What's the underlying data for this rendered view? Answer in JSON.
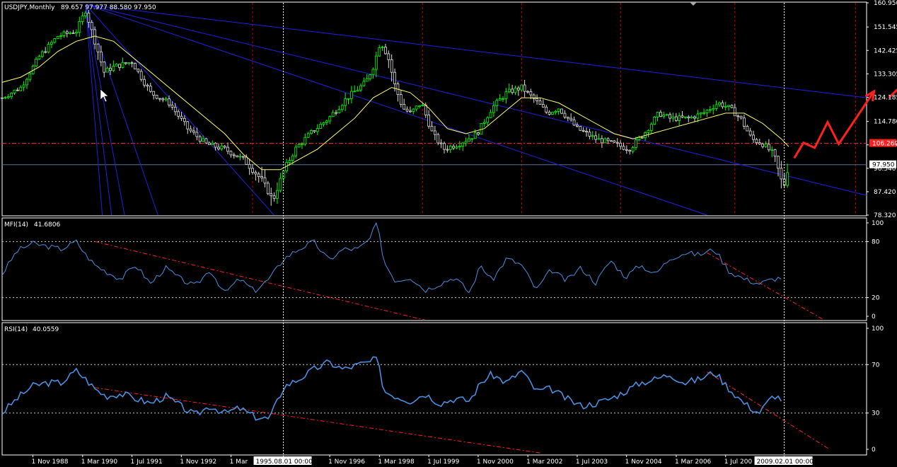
{
  "colors": {
    "background": "#000000",
    "frame": "#ffffff",
    "bull_candle": "#00ff00",
    "price_line": "#5a6e96",
    "ma": "#ffff64",
    "fan": "#2020e0",
    "red": "#ff2020",
    "vline_red": "#c00000",
    "indicator": "#4a8fe0",
    "dotted": "#c8c8c8"
  },
  "chart_data": [
    {
      "type": "candlestick",
      "panel": "price",
      "title": "USDJPY,Monthly",
      "ohlc_readout": "89.657 97.977 88.580 97.950",
      "ylim": [
        78.32,
        160.95
      ],
      "ytick_labels": [
        "160.950",
        "151.545",
        "142.425",
        "133.305",
        "124.185",
        "114.780",
        "105.660",
        "96.540",
        "87.420",
        "78.320"
      ],
      "ytick_values": [
        160.95,
        151.545,
        142.425,
        133.305,
        124.185,
        114.78,
        105.66,
        96.54,
        87.42,
        78.32
      ],
      "current_price_label": "97.950",
      "current_price": 97.95,
      "red_level_label": "106.260",
      "red_level": 106.26,
      "xlim": [
        1988.0,
        2011.3
      ],
      "x_tick_labels": [
        "1 Nov 1988",
        "1 Mar 1990",
        "1 Jul 1991",
        "1 Nov 1992",
        "1 Mar",
        "1 Nov 1996",
        "1 Mar 1998",
        "1 Jul 1999",
        "1 Nov 2000",
        "1 Mar 2002",
        "1 Jul 2003",
        "1 Nov 2004",
        "1 Mar 2006",
        "1 Jul 200"
      ],
      "x_tick_values": [
        1988.83,
        1990.17,
        1991.5,
        1992.83,
        1994.17,
        1996.83,
        1998.17,
        1999.5,
        2000.83,
        2002.17,
        2003.5,
        2004.83,
        2006.17,
        2007.5
      ],
      "crosshair_labels": [
        "1995.08.01 00:00",
        "2009.02.01 00:00"
      ],
      "crosshair_x": [
        1995.58,
        2009.08
      ],
      "vertical_red_lines": [
        1994.75,
        1999.33,
        2002.0,
        2004.67,
        2007.75,
        2011.0
      ],
      "anchor": {
        "x": 1990.25,
        "y": 160.3
      },
      "fan_lines": [
        {
          "to": [
            2011.3,
            124.0
          ]
        },
        {
          "to": [
            2011.3,
            86.0
          ]
        },
        {
          "to": [
            2007.0,
            78.32
          ]
        },
        {
          "to": [
            1995.33,
            78.32
          ]
        },
        {
          "to": [
            1992.2,
            78.32
          ]
        },
        {
          "to": [
            1991.3,
            78.32
          ]
        },
        {
          "to": [
            1990.95,
            78.32
          ]
        },
        {
          "to": [
            1990.7,
            78.32
          ]
        }
      ],
      "red_drawn_path": [
        [
          2009.35,
          100.5
        ],
        [
          2009.6,
          106.5
        ],
        [
          2009.9,
          104.5
        ],
        [
          2010.25,
          114.5
        ],
        [
          2010.55,
          106.0
        ],
        [
          2011.5,
          126.5
        ]
      ],
      "red_arrow_segment": [
        [
          2011.9,
          124.0
        ],
        [
          2012.9,
          138.0
        ]
      ],
      "close_series": {
        "x": [
          1988.0,
          1988.5,
          1989.0,
          1989.5,
          1990.0,
          1990.25,
          1990.5,
          1990.75,
          1991.0,
          1991.5,
          1992.0,
          1992.5,
          1993.0,
          1993.5,
          1994.0,
          1994.5,
          1995.0,
          1995.3,
          1995.6,
          1995.9,
          1996.3,
          1996.8,
          1997.3,
          1997.8,
          1998.0,
          1998.2,
          1998.4,
          1998.6,
          1998.8,
          1999.0,
          1999.3,
          1999.6,
          1999.9,
          2000.3,
          2000.8,
          2001.2,
          2001.6,
          2002.0,
          2002.3,
          2002.7,
          2003.0,
          2003.5,
          2004.0,
          2004.5,
          2004.9,
          2005.3,
          2005.7,
          2006.0,
          2006.5,
          2006.9,
          2007.3,
          2007.6,
          2007.9,
          2008.2,
          2008.5,
          2008.8,
          2009.0,
          2009.08,
          2009.2
        ],
        "y": [
          124,
          128,
          140,
          148,
          150,
          158,
          146,
          134,
          136,
          138,
          126,
          122,
          112,
          106,
          104,
          100,
          92,
          84,
          96,
          104,
          110,
          116,
          124,
          130,
          136,
          146,
          140,
          128,
          120,
          118,
          122,
          110,
          104,
          106,
          110,
          120,
          126,
          128,
          124,
          118,
          120,
          112,
          108,
          106,
          104,
          110,
          118,
          116,
          116,
          118,
          122,
          120,
          116,
          108,
          106,
          102,
          92,
          90,
          97.95
        ],
        "range": [
          2,
          3,
          4,
          4,
          3,
          6,
          7,
          5,
          5,
          4,
          4,
          3,
          4,
          4,
          4,
          5,
          8,
          8,
          5,
          4,
          3,
          4,
          5,
          5,
          6,
          7,
          8,
          8,
          5,
          5,
          4,
          5,
          4,
          4,
          4,
          5,
          5,
          5,
          4,
          4,
          4,
          4,
          4,
          4,
          4,
          4,
          4,
          4,
          4,
          4,
          4,
          4,
          4,
          5,
          5,
          6,
          8,
          8,
          8
        ]
      },
      "ma_series": {
        "x": [
          1988.0,
          1988.5,
          1989.0,
          1989.5,
          1990.0,
          1990.5,
          1991.0,
          1991.5,
          1992.0,
          1992.5,
          1993.0,
          1993.5,
          1994.0,
          1994.5,
          1995.0,
          1995.5,
          1996.0,
          1996.5,
          1997.0,
          1997.5,
          1998.0,
          1998.5,
          1999.0,
          1999.5,
          2000.0,
          2000.5,
          2001.0,
          2001.5,
          2002.0,
          2002.5,
          2003.0,
          2003.5,
          2004.0,
          2004.5,
          2005.0,
          2005.5,
          2006.0,
          2006.5,
          2007.0,
          2007.5,
          2008.0,
          2008.5,
          2009.0,
          2009.2
        ],
        "y": [
          130,
          132,
          136,
          142,
          146,
          148,
          146,
          140,
          134,
          128,
          122,
          116,
          110,
          102,
          96,
          96,
          100,
          104,
          110,
          116,
          124,
          128,
          126,
          120,
          112,
          110,
          112,
          118,
          124,
          124,
          122,
          118,
          114,
          110,
          108,
          110,
          112,
          114,
          116,
          118,
          118,
          114,
          108,
          105
        ]
      }
    },
    {
      "type": "line",
      "panel": "mfi",
      "title": "MFI(14)",
      "value_readout": "41.6806",
      "ylim": [
        0,
        100
      ],
      "ytick_labels": [
        "100",
        "80",
        "20",
        "0"
      ],
      "ytick_values": [
        100,
        80,
        20,
        0
      ],
      "dotted_levels": [
        80,
        20
      ],
      "series": [
        {
          "x": [
            1988.0,
            1988.4,
            1988.8,
            1989.2,
            1989.6,
            1990.0,
            1990.25,
            1990.5,
            1990.8,
            1991.2,
            1991.6,
            1992.0,
            1992.4,
            1992.8,
            1993.2,
            1993.6,
            1994.0,
            1994.4,
            1994.8,
            1995.2,
            1995.6,
            1996.0,
            1996.4,
            1996.8,
            1997.2,
            1997.6,
            1997.9,
            1998.1,
            1998.3,
            1998.6,
            1999.0,
            1999.4,
            1999.8,
            2000.2,
            2000.6,
            2000.9,
            2001.2,
            2001.6,
            2002.0,
            2002.4,
            2002.8,
            2003.2,
            2003.6,
            2004.0,
            2004.4,
            2004.8,
            2005.2,
            2005.6,
            2006.0,
            2006.4,
            2006.8,
            2007.2,
            2007.6,
            2008.0,
            2008.4,
            2008.8,
            2009.08
          ],
          "y": [
            45,
            70,
            78,
            75,
            72,
            80,
            66,
            55,
            48,
            40,
            55,
            35,
            52,
            40,
            32,
            50,
            25,
            40,
            27,
            40,
            62,
            72,
            80,
            60,
            72,
            72,
            82,
            100,
            58,
            38,
            42,
            28,
            35,
            42,
            25,
            55,
            38,
            62,
            55,
            28,
            50,
            38,
            52,
            36,
            60,
            42,
            55,
            45,
            62,
            68,
            66,
            72,
            48,
            40,
            35,
            40,
            42
          ]
        }
      ],
      "trendlines": [
        {
          "points": [
            [
              1990.5,
              80
            ],
            [
              1999.5,
              -5
            ]
          ]
        },
        {
          "points": [
            [
              2007.0,
              68
            ],
            [
              2010.2,
              -5
            ]
          ]
        }
      ]
    },
    {
      "type": "line",
      "panel": "rsi",
      "title": "RSI(14)",
      "value_readout": "40.0559",
      "ylim": [
        0,
        100
      ],
      "ytick_labels": [
        "100",
        "70",
        "30",
        "0"
      ],
      "ytick_values": [
        100,
        70,
        30,
        0
      ],
      "dotted_levels": [
        70,
        30
      ],
      "series": [
        {
          "x": [
            1988.0,
            1988.4,
            1988.8,
            1989.2,
            1989.6,
            1990.0,
            1990.25,
            1990.5,
            1990.8,
            1991.2,
            1991.6,
            1992.0,
            1992.4,
            1992.8,
            1993.2,
            1993.6,
            1994.0,
            1994.4,
            1994.8,
            1995.2,
            1995.6,
            1996.0,
            1996.4,
            1996.8,
            1997.2,
            1997.6,
            1997.9,
            1998.1,
            1998.3,
            1998.6,
            1999.0,
            1999.4,
            1999.8,
            2000.2,
            2000.6,
            2000.9,
            2001.2,
            2001.6,
            2002.0,
            2002.4,
            2002.8,
            2003.2,
            2003.6,
            2004.0,
            2004.4,
            2004.8,
            2005.2,
            2005.6,
            2006.0,
            2006.4,
            2006.8,
            2007.2,
            2007.6,
            2008.0,
            2008.4,
            2008.8,
            2009.08
          ],
          "y": [
            30,
            42,
            52,
            55,
            55,
            65,
            58,
            50,
            44,
            46,
            42,
            38,
            44,
            36,
            28,
            36,
            30,
            34,
            27,
            25,
            52,
            58,
            66,
            72,
            66,
            70,
            72,
            75,
            48,
            44,
            40,
            46,
            38,
            42,
            40,
            55,
            62,
            55,
            65,
            48,
            50,
            42,
            36,
            38,
            42,
            48,
            55,
            58,
            62,
            55,
            58,
            64,
            50,
            38,
            30,
            45,
            40
          ]
        }
      ],
      "trendlines": [
        {
          "points": [
            [
              1990.5,
              51
            ],
            [
              2002.5,
              -3
            ]
          ]
        },
        {
          "points": [
            [
              2007.0,
              64
            ],
            [
              2010.3,
              0
            ]
          ]
        }
      ]
    }
  ]
}
